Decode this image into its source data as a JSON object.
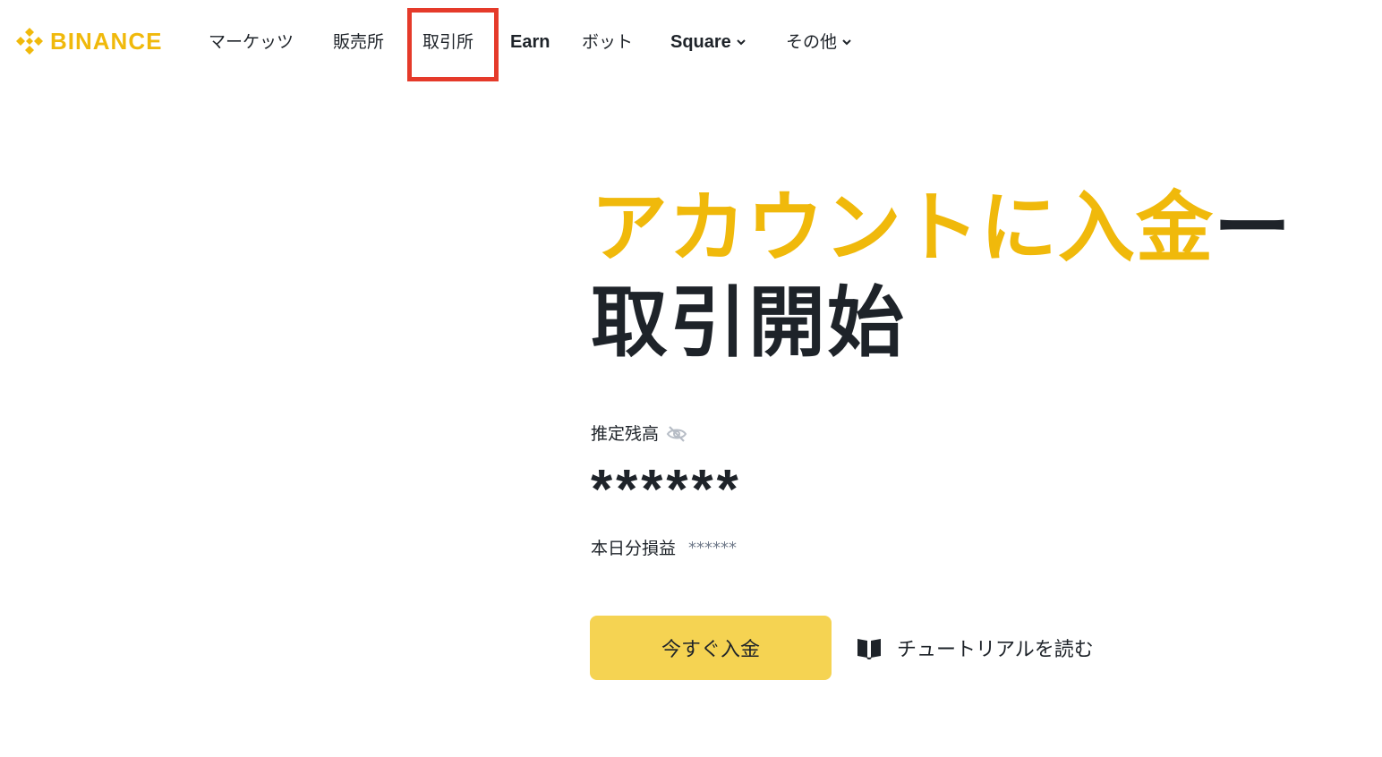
{
  "brand": {
    "name": "BINANCE",
    "logo_icon": "binance-diamond-icon",
    "color": "#F0B90B"
  },
  "nav": {
    "items": [
      {
        "label": "マーケッツ"
      },
      {
        "label": "販売所"
      },
      {
        "label": "取引所"
      },
      {
        "label": "Earn"
      },
      {
        "label": "ボット"
      },
      {
        "label": "Square"
      },
      {
        "label": "その他"
      }
    ]
  },
  "hero": {
    "title_highlight": "アカウントに入金",
    "title_dash": "ー",
    "title_line2": "取引開始"
  },
  "balance": {
    "label": "推定残高",
    "visibility_icon": "eye-hidden-icon",
    "value": "******",
    "pnl_label": "本日分損益",
    "pnl_value": "******"
  },
  "actions": {
    "deposit_label": "今すぐ入金",
    "tutorial_icon": "book-icon",
    "tutorial_label": "チュートリアルを読む"
  },
  "colors": {
    "accent": "#F0B90B",
    "button": "#F5D352",
    "highlight": "#E53A2A",
    "text": "#1E2329"
  }
}
